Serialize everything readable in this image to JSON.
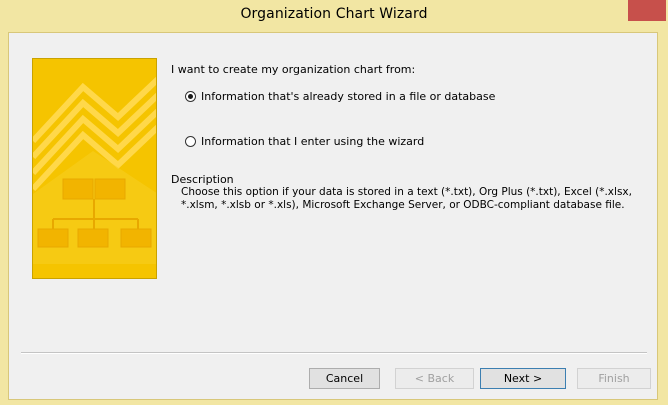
{
  "window": {
    "title": "Organization Chart Wizard"
  },
  "prompt": "I want to create my organization chart from:",
  "options": [
    {
      "label": "Information that's already stored in a file or database",
      "selected": true
    },
    {
      "label": "Information that I enter using the wizard",
      "selected": false
    }
  ],
  "description": {
    "heading": "Description",
    "text": "Choose this option if your data is stored in a text (*.txt), Org Plus (*.txt), Excel (*.xlsx, *.xlsm, *.xlsb or *.xls), Microsoft Exchange Server, or ODBC-compliant database file."
  },
  "buttons": {
    "cancel": "Cancel",
    "back": "< Back",
    "next": "Next >",
    "finish": "Finish"
  },
  "colors": {
    "art_background": "#f5c400",
    "close_button": "#c7504b",
    "frame": "#f2e6a3"
  }
}
